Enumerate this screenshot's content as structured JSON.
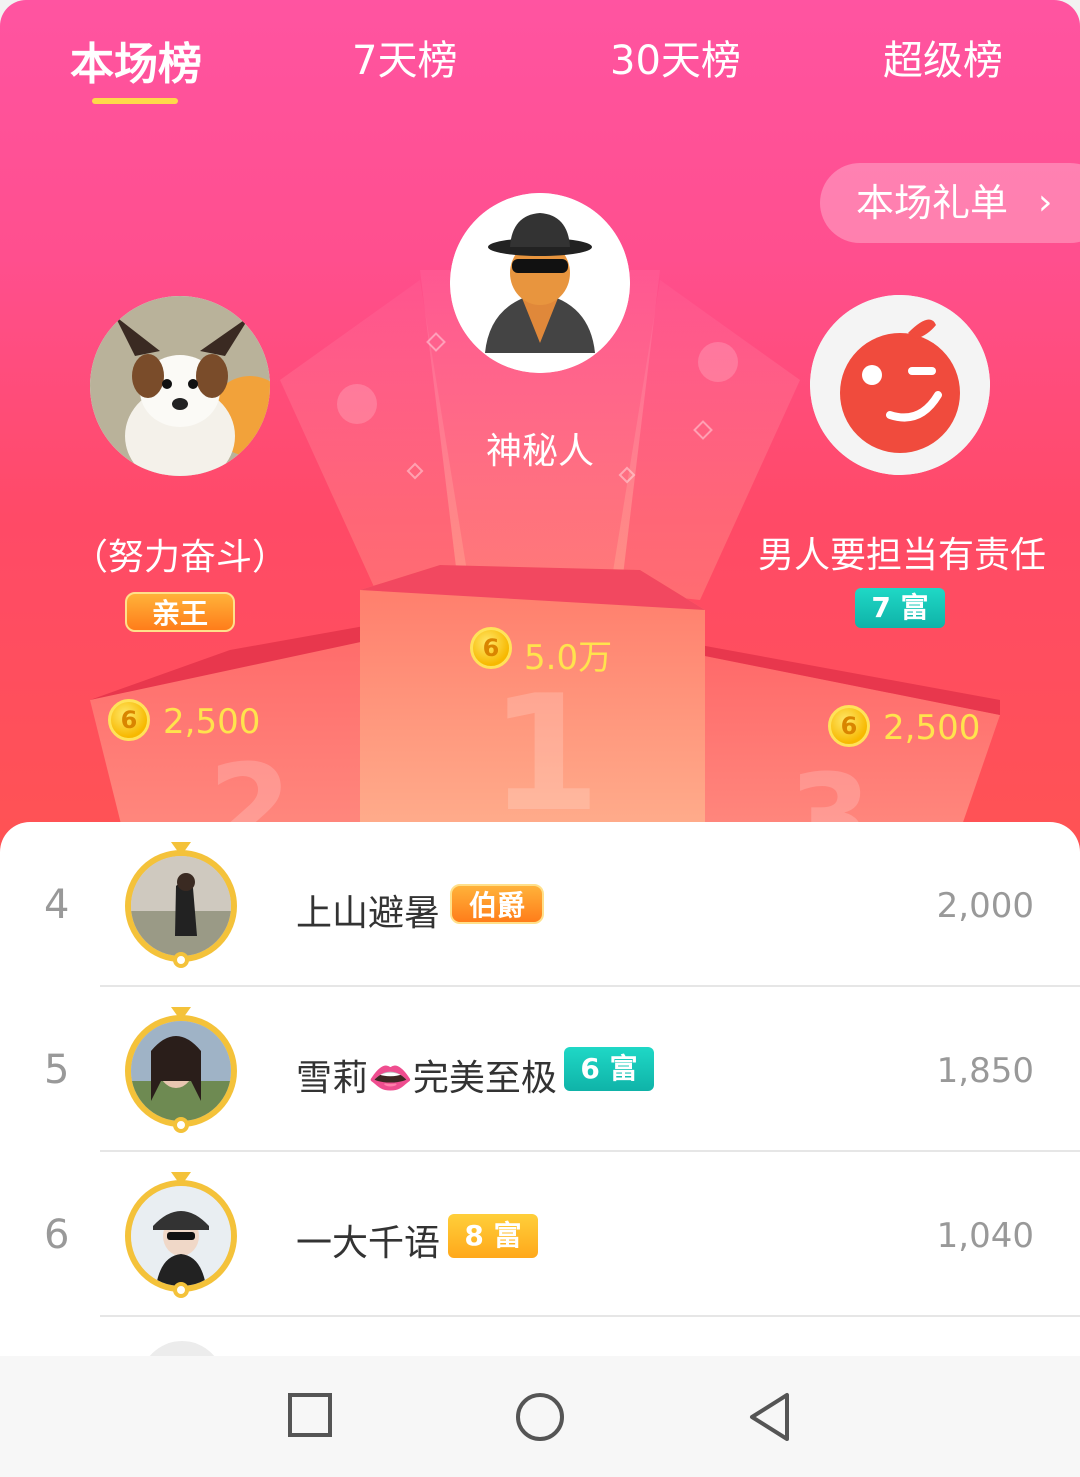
{
  "tabs": [
    {
      "label": "本场榜"
    },
    {
      "label": "7天榜"
    },
    {
      "label": "30天榜"
    },
    {
      "label": "超级榜"
    }
  ],
  "gift_list_button": {
    "label": "本场礼单"
  },
  "podium": {
    "first": {
      "name": "神秘人",
      "amount": "5.0万",
      "rank_label": "1"
    },
    "second": {
      "name": "（努力奋斗）",
      "amount": "2,500",
      "noble_badge": "亲王",
      "rank_label": "2"
    },
    "third": {
      "name": "男人要担当有责任",
      "amount": "2,500",
      "wealth_badge": "7 富",
      "rank_label": "3"
    }
  },
  "coin_glyph": "6",
  "list": [
    {
      "rank": "4",
      "name": "上山避暑",
      "badge": "伯爵",
      "badge_type": "noble",
      "score": "2,000"
    },
    {
      "rank": "5",
      "name": "雪莉👄完美至极",
      "badge": "6 富",
      "badge_type": "teal",
      "score": "1,850"
    },
    {
      "rank": "6",
      "name": "一大千语",
      "badge": "8 富",
      "badge_type": "orange",
      "score": "1,040"
    }
  ],
  "colors": {
    "accent_gold": "#ffd84a",
    "coin_text": "#ffe34d",
    "teal": "#1fd8c6",
    "orange": "#ffa81b"
  },
  "icons": {
    "chevron": "chevron-right-icon",
    "nav": [
      "square-icon",
      "circle-icon",
      "triangle-back-icon"
    ]
  }
}
